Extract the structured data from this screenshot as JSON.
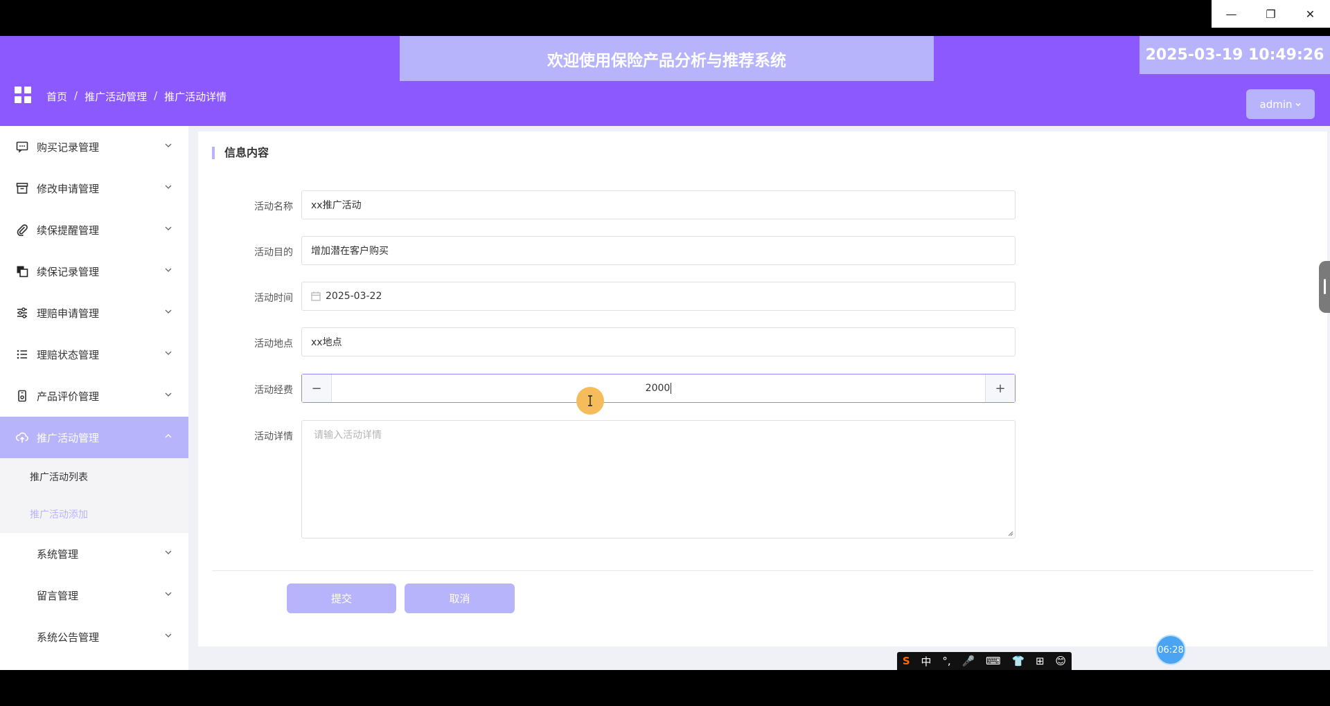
{
  "window": {
    "minimize": "—",
    "restore": "❐",
    "close": "✕"
  },
  "header": {
    "welcome": "欢迎使用保险产品分析与推荐系统",
    "datetime": "2025-03-19 10:49:26",
    "breadcrumb": [
      "首页",
      "推广活动管理",
      "推广活动详情"
    ],
    "user": "admin"
  },
  "sidebar": {
    "items": [
      {
        "label": "购买记录管理",
        "icon": "chat-icon"
      },
      {
        "label": "修改申请管理",
        "icon": "archive-icon"
      },
      {
        "label": "续保提醒管理",
        "icon": "paperclip-icon"
      },
      {
        "label": "续保记录管理",
        "icon": "copy-icon"
      },
      {
        "label": "理赔申请管理",
        "icon": "sliders-icon"
      },
      {
        "label": "理赔状态管理",
        "icon": "list-icon"
      },
      {
        "label": "产品评价管理",
        "icon": "phone-icon"
      },
      {
        "label": "推广活动管理",
        "icon": "cloud-upload-icon"
      }
    ],
    "sub_items": [
      "推广活动列表",
      "推广活动添加"
    ],
    "extra_items": [
      "系统管理",
      "留言管理",
      "系统公告管理"
    ]
  },
  "form": {
    "section_title": "信息内容",
    "name": {
      "label": "活动名称",
      "value": "xx推广活动"
    },
    "purpose": {
      "label": "活动目的",
      "value": "增加潜在客户购买"
    },
    "time": {
      "label": "活动时间",
      "value": "2025-03-22"
    },
    "location": {
      "label": "活动地点",
      "value": "xx地点"
    },
    "fee": {
      "label": "活动经费",
      "value": "2000",
      "minus": "−",
      "plus": "+"
    },
    "detail": {
      "label": "活动详情",
      "placeholder": "请输入活动详情"
    },
    "submit": "提交",
    "cancel": "取消"
  },
  "overlay": {
    "timer": "06:28",
    "ime": [
      "中",
      "°,",
      "🎤",
      "⌨",
      "👕",
      "⊞",
      "😊"
    ]
  },
  "colors": {
    "accent": "#8c59ff",
    "light_accent": "#b8b4fb"
  }
}
